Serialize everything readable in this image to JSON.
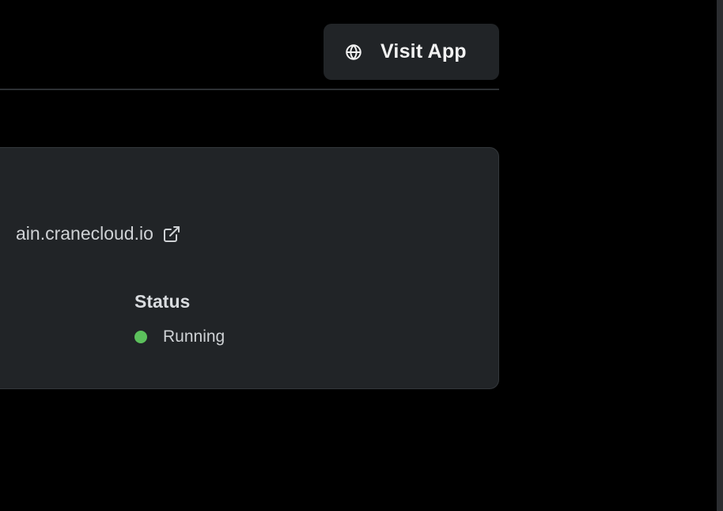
{
  "header": {
    "visit_button_label": "Visit App",
    "visit_button_icon": "globe-icon"
  },
  "app_card": {
    "url_text": "ain.cranecloud.io",
    "url_icon": "external-link-icon",
    "status": {
      "title": "Status",
      "value": "Running",
      "color": "#5cc05c"
    }
  },
  "colors": {
    "background": "#000000",
    "surface": "#212427",
    "text": "#cfd2d5",
    "status_running": "#5cc05c"
  }
}
